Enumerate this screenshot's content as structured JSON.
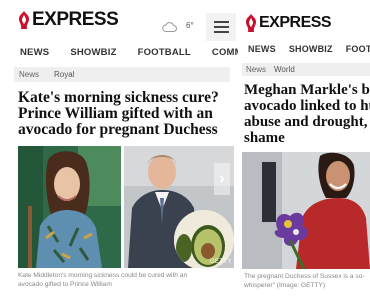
{
  "left": {
    "logo_text": "EXPRESS",
    "weather": {
      "icon": "cloud-icon",
      "temperature": "6°"
    },
    "menu_icon": "hamburger-icon",
    "nav": [
      "NEWS",
      "SHOWBIZ",
      "FOOTBALL",
      "COMMENT"
    ],
    "breadcrumb": {
      "section": "News",
      "subsection": "Royal"
    },
    "headline": "Kate's morning sickness cure?\nPrince William gifted with an\navocado for pregnant Duchess",
    "photo_credit": "GETTY",
    "next_icon": "chevron-right-icon",
    "caption": "Kate Middleton's morning sickness could be cured with an\navocado gifted to Prince William"
  },
  "right": {
    "logo_text": "EXPRESS",
    "nav": [
      "NEWS",
      "SHOWBIZ",
      "FOOTB"
    ],
    "breadcrumb": {
      "section": "News",
      "subsection": "World"
    },
    "headline": "Meghan Markle's bel\navocado linked to hu\nabuse and drought, n\nshame",
    "caption": "The pregnant Duchess of Sussex is a so-\nwhisperer\" (Image: GETTY)"
  },
  "colors": {
    "logo_red": "#c8102e",
    "subnav_bg": "#efefef",
    "text": "#111111"
  }
}
